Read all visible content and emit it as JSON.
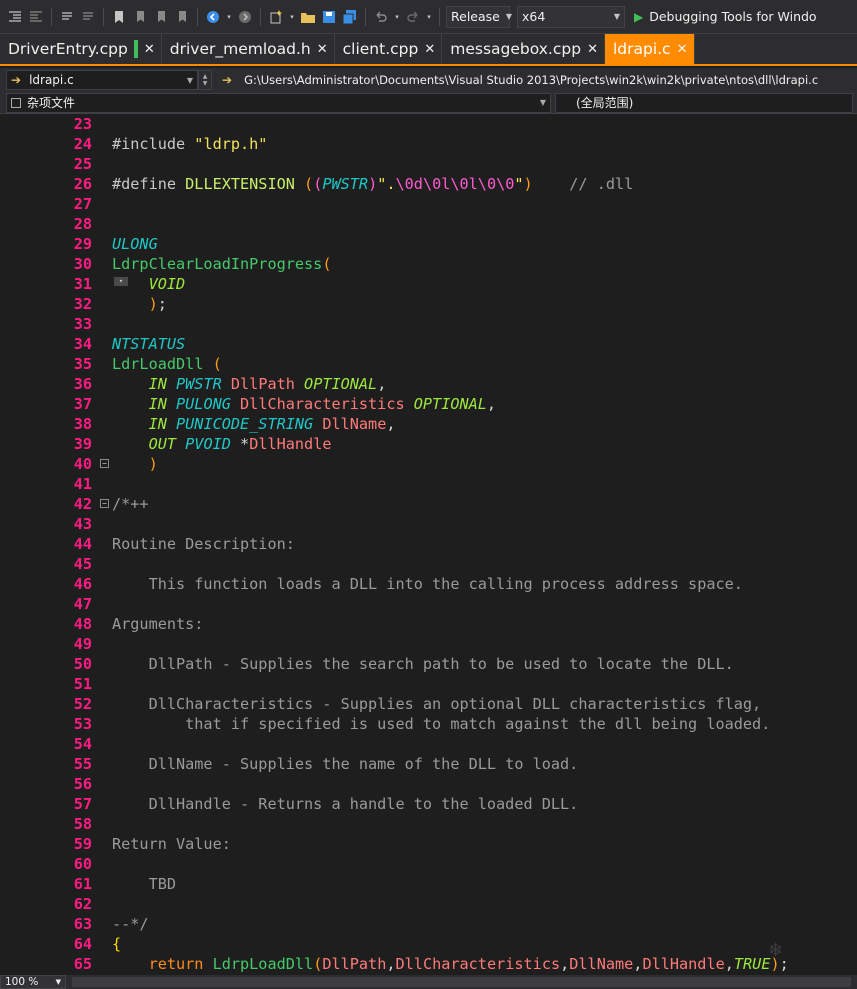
{
  "toolbar": {
    "configuration": "Release",
    "platform": "x64",
    "run_label": "Debugging Tools for Windo"
  },
  "tabs": [
    {
      "label": "DriverEntry.cpp",
      "active": false,
      "modified": true
    },
    {
      "label": "driver_memload.h",
      "active": false
    },
    {
      "label": "client.cpp",
      "active": false
    },
    {
      "label": "messagebox.cpp",
      "active": false
    },
    {
      "label": "ldrapi.c",
      "active": true
    }
  ],
  "nav": {
    "file": "ldrapi.c",
    "path": "G:\\Users\\Administrator\\Documents\\Visual Studio 2013\\Projects\\win2k\\win2k\\private\\ntos\\dll\\ldrapi.c",
    "project": "杂项文件",
    "scope": "(全局范围)"
  },
  "status": {
    "zoom": "100 %"
  },
  "colors": {
    "accent_tab": "#ff8c00",
    "line_number": "#ff1b82",
    "background": "#1e1e1e"
  },
  "code_lines": [
    {
      "n": "23",
      "segs": []
    },
    {
      "n": "24",
      "segs": [
        [
          "c-pre",
          "#include "
        ],
        [
          "c-str",
          "\"ldrp.h\""
        ]
      ]
    },
    {
      "n": "25",
      "segs": []
    },
    {
      "n": "26",
      "segs": [
        [
          "c-pre",
          "#define "
        ],
        [
          "c-id",
          "DLLEXTENSION "
        ],
        [
          "c-p1",
          "("
        ],
        [
          "c-p2",
          "("
        ],
        [
          "c-type",
          "PWSTR"
        ],
        [
          "c-p2",
          ")"
        ],
        [
          "c-str",
          "\"."
        ],
        [
          "c-strs",
          "\\0d\\0l\\0l\\0\\0"
        ],
        [
          "c-str",
          "\""
        ],
        [
          "c-p1",
          ")"
        ],
        [
          "c-com",
          "    // .dll"
        ]
      ]
    },
    {
      "n": "27",
      "segs": []
    },
    {
      "n": "28",
      "segs": []
    },
    {
      "n": "29",
      "segs": [
        [
          "c-type",
          "ULONG"
        ]
      ]
    },
    {
      "n": "30",
      "segs": [
        [
          "c-fn",
          "LdrpClearLoadInProgress"
        ],
        [
          "c-p1",
          "("
        ]
      ]
    },
    {
      "n": "31",
      "segs": [
        [
          "c-w",
          "    "
        ],
        [
          "c-kw",
          "VOID"
        ]
      ],
      "mini": true
    },
    {
      "n": "32",
      "segs": [
        [
          "c-w",
          "    "
        ],
        [
          "c-p1",
          ")"
        ],
        [
          "c-w",
          ";"
        ]
      ]
    },
    {
      "n": "33",
      "segs": []
    },
    {
      "n": "34",
      "segs": [
        [
          "c-type",
          "NTSTATUS"
        ]
      ]
    },
    {
      "n": "35",
      "segs": [
        [
          "c-fn",
          "LdrLoadDll "
        ],
        [
          "c-p1",
          "("
        ]
      ]
    },
    {
      "n": "36",
      "segs": [
        [
          "c-w",
          "    "
        ],
        [
          "c-kw",
          "IN "
        ],
        [
          "c-type",
          "PWSTR "
        ],
        [
          "c-par",
          "DllPath "
        ],
        [
          "c-kw",
          "OPTIONAL"
        ],
        [
          "c-w",
          ","
        ]
      ]
    },
    {
      "n": "37",
      "segs": [
        [
          "c-w",
          "    "
        ],
        [
          "c-kw",
          "IN "
        ],
        [
          "c-type",
          "PULONG "
        ],
        [
          "c-par",
          "DllCharacteristics "
        ],
        [
          "c-kw",
          "OPTIONAL"
        ],
        [
          "c-w",
          ","
        ]
      ]
    },
    {
      "n": "38",
      "segs": [
        [
          "c-w",
          "    "
        ],
        [
          "c-kw",
          "IN "
        ],
        [
          "c-type",
          "PUNICODE_STRING "
        ],
        [
          "c-par",
          "DllName"
        ],
        [
          "c-w",
          ","
        ]
      ]
    },
    {
      "n": "39",
      "segs": [
        [
          "c-w",
          "    "
        ],
        [
          "c-kw",
          "OUT "
        ],
        [
          "c-type",
          "PVOID "
        ],
        [
          "c-w",
          "*"
        ],
        [
          "c-par",
          "DllHandle"
        ]
      ]
    },
    {
      "n": "40",
      "segs": [
        [
          "c-w",
          "    "
        ],
        [
          "c-p1",
          ")"
        ]
      ],
      "fold": "-"
    },
    {
      "n": "41",
      "segs": []
    },
    {
      "n": "42",
      "segs": [
        [
          "c-com",
          "/*++"
        ]
      ],
      "fold": "-"
    },
    {
      "n": "43",
      "segs": []
    },
    {
      "n": "44",
      "segs": [
        [
          "c-com",
          "Routine Description:"
        ]
      ]
    },
    {
      "n": "45",
      "segs": []
    },
    {
      "n": "46",
      "segs": [
        [
          "c-com",
          "    This function loads a DLL into the calling process address space."
        ]
      ]
    },
    {
      "n": "47",
      "segs": []
    },
    {
      "n": "48",
      "segs": [
        [
          "c-com",
          "Arguments:"
        ]
      ]
    },
    {
      "n": "49",
      "segs": []
    },
    {
      "n": "50",
      "segs": [
        [
          "c-com",
          "    DllPath - Supplies the search path to be used to locate the DLL."
        ]
      ]
    },
    {
      "n": "51",
      "segs": []
    },
    {
      "n": "52",
      "segs": [
        [
          "c-com",
          "    DllCharacteristics - Supplies an optional DLL characteristics flag,"
        ]
      ]
    },
    {
      "n": "53",
      "segs": [
        [
          "c-com",
          "        that if specified is used to match against the dll being loaded."
        ]
      ]
    },
    {
      "n": "54",
      "segs": []
    },
    {
      "n": "55",
      "segs": [
        [
          "c-com",
          "    DllName - Supplies the name of the DLL to load."
        ]
      ]
    },
    {
      "n": "56",
      "segs": []
    },
    {
      "n": "57",
      "segs": [
        [
          "c-com",
          "    DllHandle - Returns a handle to the loaded DLL."
        ]
      ]
    },
    {
      "n": "58",
      "segs": []
    },
    {
      "n": "59",
      "segs": [
        [
          "c-com",
          "Return Value:"
        ]
      ]
    },
    {
      "n": "60",
      "segs": []
    },
    {
      "n": "61",
      "segs": [
        [
          "c-com",
          "    TBD"
        ]
      ]
    },
    {
      "n": "62",
      "segs": []
    },
    {
      "n": "63",
      "segs": [
        [
          "c-com",
          "--*/"
        ]
      ]
    },
    {
      "n": "64",
      "segs": [
        [
          "c-brace",
          "{"
        ]
      ]
    },
    {
      "n": "65",
      "segs": [
        [
          "c-w",
          "    "
        ],
        [
          "c-kw2",
          "return "
        ],
        [
          "c-fn",
          "LdrpLoadDll"
        ],
        [
          "c-p1",
          "("
        ],
        [
          "c-par",
          "DllPath"
        ],
        [
          "c-w",
          ","
        ],
        [
          "c-par",
          "DllCharacteristics"
        ],
        [
          "c-w",
          ","
        ],
        [
          "c-par",
          "DllName"
        ],
        [
          "c-w",
          ","
        ],
        [
          "c-par",
          "DllHandle"
        ],
        [
          "c-w",
          ","
        ],
        [
          "c-kw",
          "TRUE"
        ],
        [
          "c-p1",
          ")"
        ],
        [
          "c-w",
          ";"
        ]
      ]
    }
  ]
}
